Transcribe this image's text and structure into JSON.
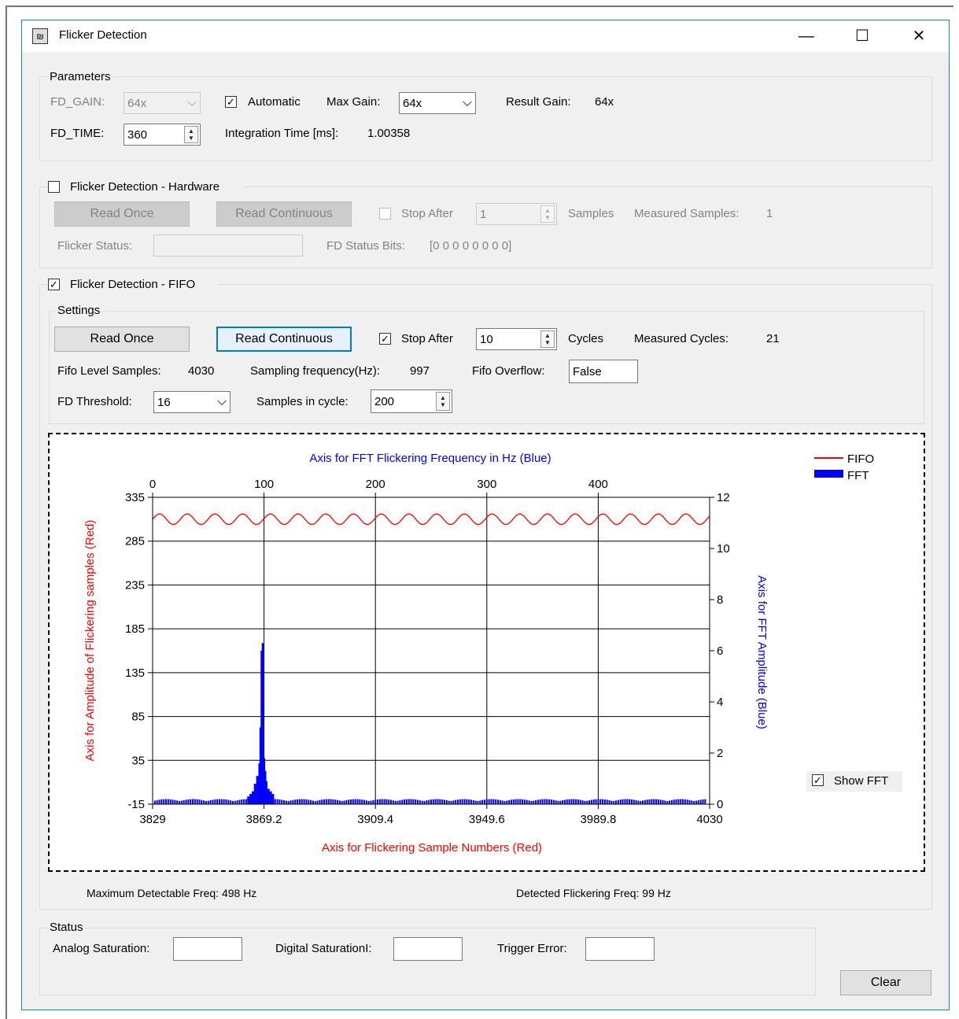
{
  "window": {
    "title": "Flicker Detection",
    "icon_name": "app-icon",
    "minimize": "—",
    "maximize": "☐",
    "close": "✕"
  },
  "parameters": {
    "legend": "Parameters",
    "fd_gain_label": "FD_GAIN:",
    "fd_gain_value": "64x",
    "automatic_label": "Automatic",
    "automatic_checked": true,
    "max_gain_label": "Max Gain:",
    "max_gain_value": "64x",
    "result_gain_label": "Result Gain:",
    "result_gain_value": "64x",
    "fd_time_label": "FD_TIME:",
    "fd_time_value": "360",
    "integration_label": "Integration Time [ms]:",
    "integration_value": "1.00358"
  },
  "hardware": {
    "legend": "Flicker Detection - Hardware",
    "enabled": false,
    "read_once": "Read Once",
    "read_continuous": "Read Continuous",
    "stop_after_label": "Stop After",
    "stop_after_value": "1",
    "samples_label": "Samples",
    "measured_samples_label": "Measured Samples:",
    "measured_samples_value": "1",
    "flicker_status_label": "Flicker Status:",
    "flicker_status_value": "",
    "fd_status_bits_label": "FD Status Bits:",
    "fd_status_bits_value": "[0 0 0 0 0 0 0 0]"
  },
  "fifo": {
    "legend": "Flicker Detection - FIFO",
    "enabled": true,
    "settings_legend": "Settings",
    "read_once": "Read Once",
    "read_continuous": "Read Continuous",
    "stop_after_label": "Stop After",
    "stop_after_checked": true,
    "stop_after_value": "10",
    "cycles_label": "Cycles",
    "measured_cycles_label": "Measured Cycles:",
    "measured_cycles_value": "21",
    "fifo_level_label": "Fifo Level Samples:",
    "fifo_level_value": "4030",
    "sampling_freq_label": "Sampling frequency(Hz):",
    "sampling_freq_value": "997",
    "fifo_overflow_label": "Fifo Overflow:",
    "fifo_overflow_value": "False",
    "fd_threshold_label": "FD Threshold:",
    "fd_threshold_value": "16",
    "samples_in_cycle_label": "Samples in cycle:",
    "samples_in_cycle_value": "200",
    "show_fft_label": "Show FFT",
    "show_fft_checked": true,
    "max_detectable": "Maximum Detectable Freq: 498 Hz",
    "detected_freq": "Detected Flickering Freq: 99 Hz"
  },
  "status": {
    "legend": "Status",
    "analog_label": "Analog Saturation:",
    "analog_value": "",
    "digital_label": "Digital SaturationI:",
    "digital_value": "",
    "trigger_label": "Trigger Error:",
    "trigger_value": "",
    "clear_button": "Clear"
  },
  "chart_data": {
    "type": "line",
    "title": "",
    "colors": {
      "fifo": "#ff0000",
      "fft": "#0000ff"
    },
    "x_bottom": {
      "label": "Axis for Flickering Sample Numbers (Red)",
      "range": [
        3829,
        4030
      ],
      "ticks": [
        "3829",
        "3869.2",
        "3909.4",
        "3949.6",
        "3989.8",
        "4030"
      ]
    },
    "x_top": {
      "label": "Axis for FFT Flickering Frequency in Hz (Blue)",
      "range": [
        0,
        500
      ],
      "ticks": [
        "0",
        "100",
        "200",
        "300",
        "400"
      ]
    },
    "y_left": {
      "label": "Axis for Amplitude of Flickering samples (Red)",
      "range": [
        -15,
        335
      ],
      "ticks": [
        "335",
        "285",
        "235",
        "185",
        "135",
        "85",
        "35",
        "-15"
      ]
    },
    "y_right": {
      "label": "Axis for FFT Amplitude (Blue)",
      "range": [
        0,
        12
      ],
      "ticks": [
        "12",
        "10",
        "8",
        "6",
        "4",
        "2",
        "0"
      ]
    },
    "legend": {
      "position": "top-right",
      "items": [
        "FIFO",
        "FFT"
      ]
    },
    "grid": true,
    "series": [
      {
        "name": "FIFO",
        "axis": "bottom-left",
        "kind": "sine",
        "mean": 310,
        "amplitude": 6,
        "period_samples": 10
      },
      {
        "name": "FFT",
        "axis": "top-right",
        "kind": "bars",
        "baseline": 0.2,
        "peaks": [
          {
            "freq": 86,
            "amp": 0.3
          },
          {
            "freq": 88,
            "amp": 0.4
          },
          {
            "freq": 90,
            "amp": 0.5
          },
          {
            "freq": 92,
            "amp": 0.8
          },
          {
            "freq": 94,
            "amp": 1.1
          },
          {
            "freq": 96,
            "amp": 1.6
          },
          {
            "freq": 97,
            "amp": 3.0
          },
          {
            "freq": 98,
            "amp": 6.0
          },
          {
            "freq": 99,
            "amp": 6.3
          },
          {
            "freq": 100,
            "amp": 1.8
          },
          {
            "freq": 101,
            "amp": 1.3
          },
          {
            "freq": 102,
            "amp": 0.9
          },
          {
            "freq": 104,
            "amp": 0.6
          },
          {
            "freq": 106,
            "amp": 0.5
          },
          {
            "freq": 108,
            "amp": 0.4
          }
        ]
      }
    ]
  }
}
